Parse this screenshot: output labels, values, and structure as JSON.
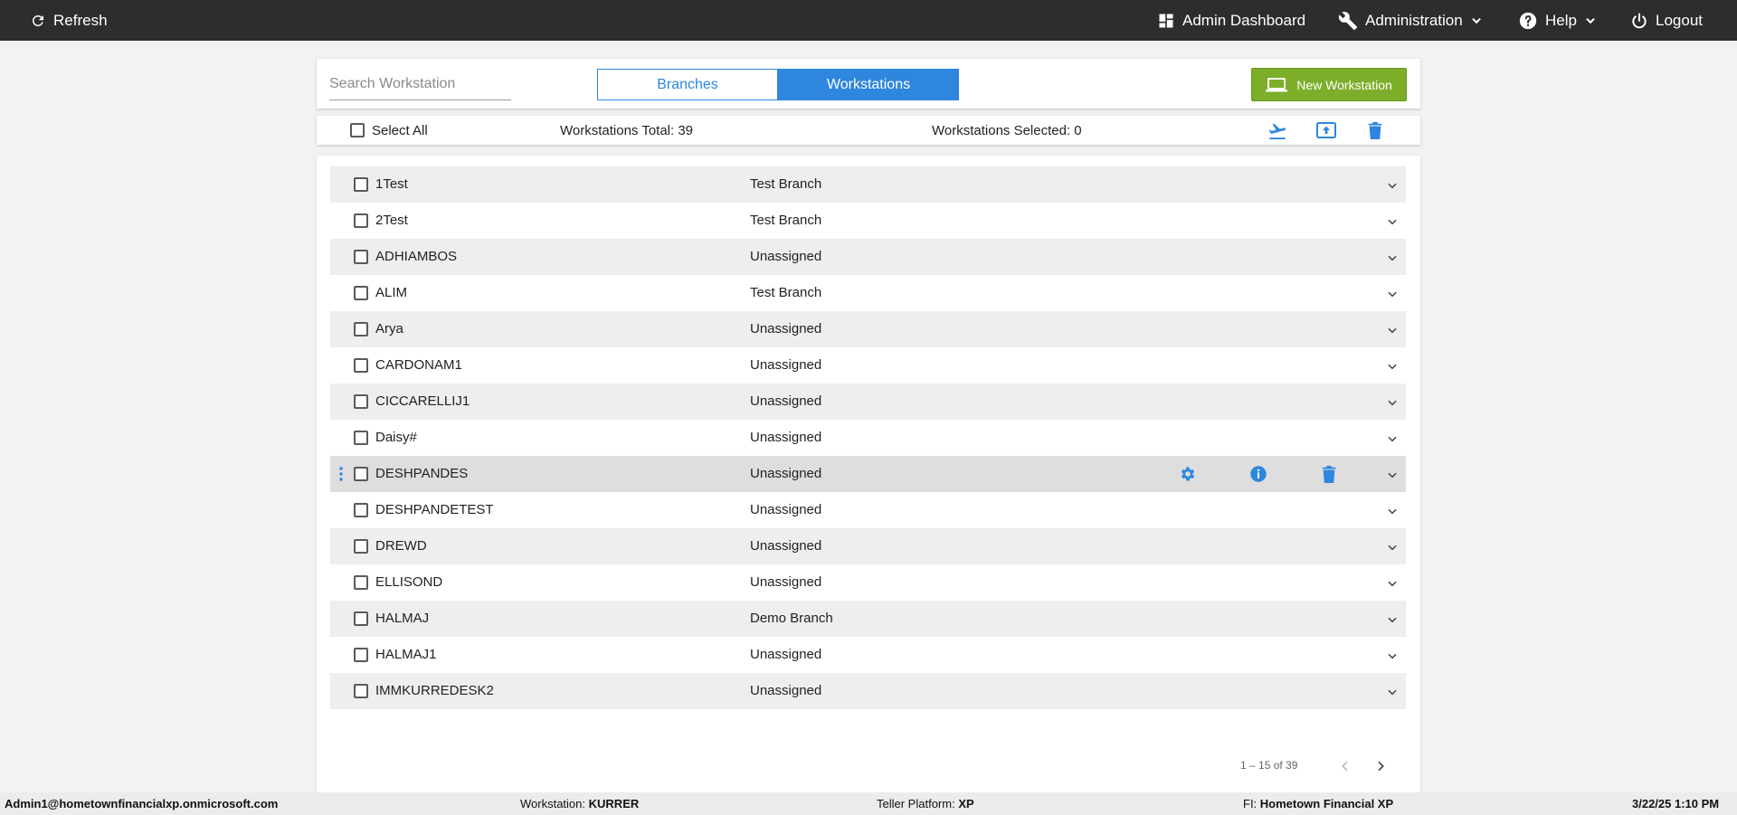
{
  "topbar": {
    "refresh_label": "Refresh",
    "admin_dashboard_label": "Admin Dashboard",
    "administration_label": "Administration",
    "help_label": "Help",
    "logout_label": "Logout"
  },
  "header": {
    "search_placeholder": "Search Workstation",
    "tab_branches": "Branches",
    "tab_workstations": "Workstations",
    "new_workstation_label": "New Workstation"
  },
  "toolbar": {
    "select_all_label": "Select All",
    "total_label": "Workstations Total: 39",
    "selected_label": "Workstations Selected: 0"
  },
  "rows": [
    {
      "name": "1Test",
      "branch": "Test Branch"
    },
    {
      "name": "2Test",
      "branch": "Test Branch"
    },
    {
      "name": "ADHIAMBOS",
      "branch": "Unassigned"
    },
    {
      "name": "ALIM",
      "branch": "Test Branch"
    },
    {
      "name": "Arya",
      "branch": "Unassigned"
    },
    {
      "name": "CARDONAM1",
      "branch": "Unassigned"
    },
    {
      "name": "CICCARELLIJ1",
      "branch": "Unassigned"
    },
    {
      "name": "Daisy#",
      "branch": "Unassigned"
    },
    {
      "name": "DESHPANDES",
      "branch": "Unassigned"
    },
    {
      "name": "DESHPANDETEST",
      "branch": "Unassigned"
    },
    {
      "name": "DREWD",
      "branch": "Unassigned"
    },
    {
      "name": "ELLISOND",
      "branch": "Unassigned"
    },
    {
      "name": "HALMAJ",
      "branch": "Demo Branch"
    },
    {
      "name": "HALMAJ1",
      "branch": "Unassigned"
    },
    {
      "name": "IMMKURREDESK2",
      "branch": "Unassigned"
    }
  ],
  "pagination": {
    "range_label": "1 – 15 of 39"
  },
  "statusbar": {
    "user": "Admin1@hometownfinancialxp.onmicrosoft.com",
    "workstation_label": "Workstation:",
    "workstation_value": "KURRER",
    "platform_label": "Teller Platform:",
    "platform_value": "XP",
    "fi_label": "FI:",
    "fi_value": "Hometown Financial XP",
    "datetime": "3/22/25 1:10 PM"
  },
  "colors": {
    "accent": "#2e86de",
    "new_button": "#7cae2a",
    "topbar": "#2d2d2d"
  }
}
